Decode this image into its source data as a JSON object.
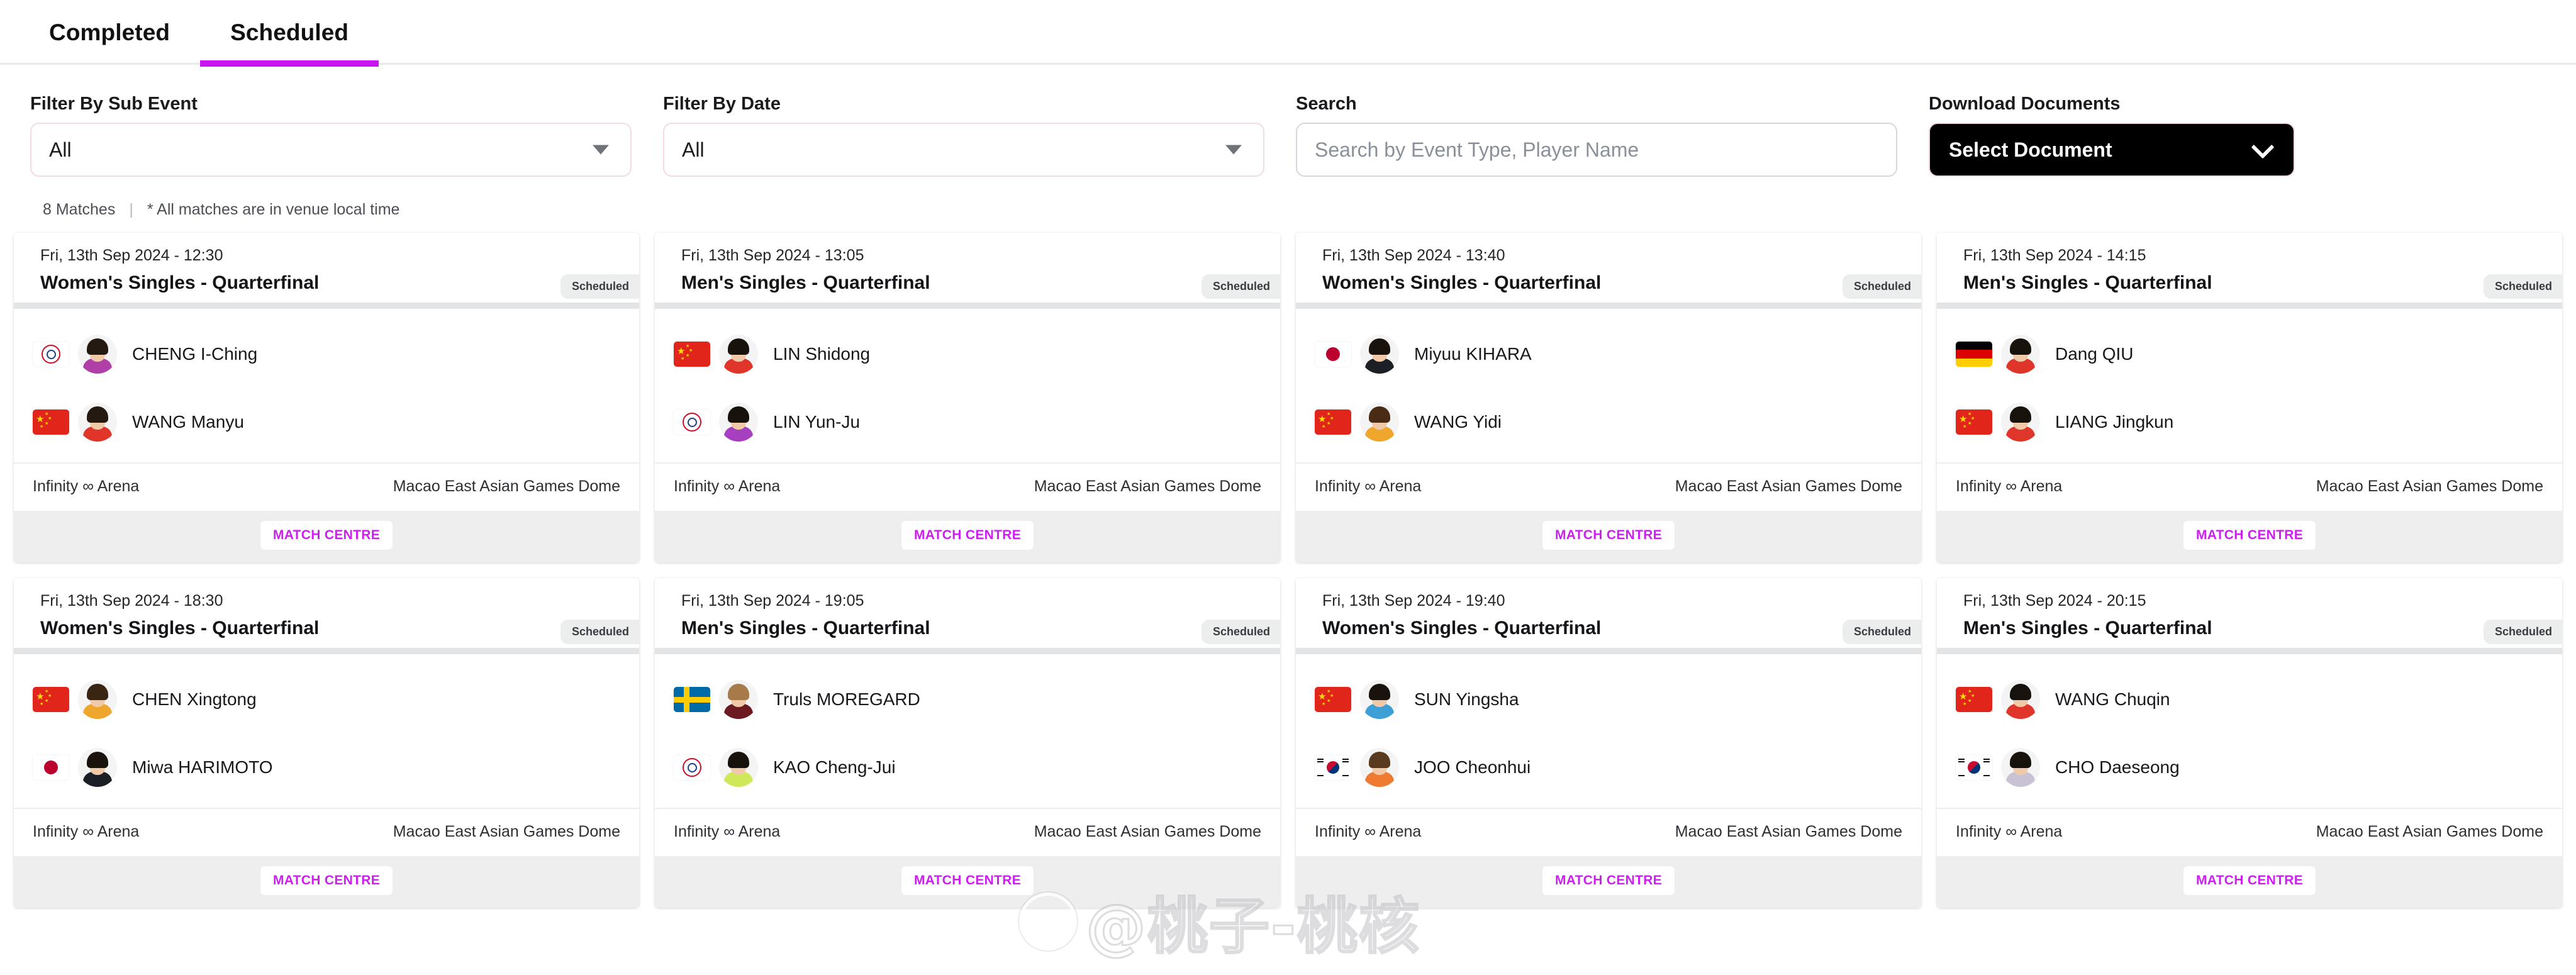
{
  "tabs": [
    {
      "label": "Completed",
      "active": false
    },
    {
      "label": "Scheduled",
      "active": true
    }
  ],
  "filters": {
    "sub_event": {
      "label": "Filter By Sub Event",
      "value": "All"
    },
    "date": {
      "label": "Filter By Date",
      "value": "All"
    },
    "search": {
      "label": "Search",
      "value": "",
      "placeholder": "Search by Event Type, Player Name"
    },
    "download": {
      "label": "Download Documents",
      "value": "Select Document"
    }
  },
  "meta": {
    "match_count": "8 Matches",
    "separator": "|",
    "note": "* All matches are in venue local time"
  },
  "accent_color": "#c913f0",
  "match_centre_label": "MATCH CENTRE",
  "status_label": "Scheduled",
  "watermark": "@桃子-桃核",
  "matches": [
    {
      "datetime": "Fri, 13th Sep 2024 - 12:30",
      "title": "Women's Singles - Quarterfinal",
      "status": "Scheduled",
      "arena": "Infinity ∞ Arena",
      "venue": "Macao East Asian Games Dome",
      "button": "MATCH CENTRE",
      "players": [
        {
          "name": "CHENG I-Ching",
          "flag": "chinese-taipei",
          "kit": "#b13fa8",
          "hair": "#241a12"
        },
        {
          "name": "WANG Manyu",
          "flag": "china",
          "kit": "#e0352b",
          "hair": "#241a12"
        }
      ]
    },
    {
      "datetime": "Fri, 13th Sep 2024 - 13:05",
      "title": "Men's Singles - Quarterfinal",
      "status": "Scheduled",
      "arena": "Infinity ∞ Arena",
      "venue": "Macao East Asian Games Dome",
      "button": "MATCH CENTRE",
      "players": [
        {
          "name": "LIN Shidong",
          "flag": "china",
          "kit": "#e0352b",
          "hair": "#18120c"
        },
        {
          "name": "LIN Yun-Ju",
          "flag": "chinese-taipei",
          "kit": "#a63fc0",
          "hair": "#18120c"
        }
      ]
    },
    {
      "datetime": "Fri, 13th Sep 2024 - 13:40",
      "title": "Women's Singles - Quarterfinal",
      "status": "Scheduled",
      "arena": "Infinity ∞ Arena",
      "venue": "Macao East Asian Games Dome",
      "button": "MATCH CENTRE",
      "players": [
        {
          "name": "Miyuu KIHARA",
          "flag": "japan",
          "kit": "#1d1f27",
          "hair": "#1a130d"
        },
        {
          "name": "WANG Yidi",
          "flag": "china",
          "kit": "#efa62c",
          "hair": "#4a2c16"
        }
      ]
    },
    {
      "datetime": "Fri, 13th Sep 2024 - 14:15",
      "title": "Men's Singles - Quarterfinal",
      "status": "Scheduled",
      "arena": "Infinity ∞ Arena",
      "venue": "Macao East Asian Games Dome",
      "button": "MATCH CENTRE",
      "players": [
        {
          "name": "Dang QIU",
          "flag": "germany",
          "kit": "#e0352b",
          "hair": "#18120c"
        },
        {
          "name": "LIANG Jingkun",
          "flag": "china",
          "kit": "#e0352b",
          "hair": "#18120c"
        }
      ]
    },
    {
      "datetime": "Fri, 13th Sep 2024 - 18:30",
      "title": "Women's Singles - Quarterfinal",
      "status": "Scheduled",
      "arena": "Infinity ∞ Arena",
      "venue": "Macao East Asian Games Dome",
      "button": "MATCH CENTRE",
      "players": [
        {
          "name": "CHEN Xingtong",
          "flag": "china",
          "kit": "#efa62c",
          "hair": "#3a2412"
        },
        {
          "name": "Miwa HARIMOTO",
          "flag": "japan",
          "kit": "#1d1f27",
          "hair": "#1a130d"
        }
      ]
    },
    {
      "datetime": "Fri, 13th Sep 2024 - 19:05",
      "title": "Men's Singles - Quarterfinal",
      "status": "Scheduled",
      "arena": "Infinity ∞ Arena",
      "venue": "Macao East Asian Games Dome",
      "button": "MATCH CENTRE",
      "players": [
        {
          "name": "Truls MOREGARD",
          "flag": "sweden",
          "kit": "#6b1a1f",
          "hair": "#a77a4a"
        },
        {
          "name": "KAO Cheng-Jui",
          "flag": "chinese-taipei",
          "kit": "#cfe85a",
          "hair": "#18120c"
        }
      ]
    },
    {
      "datetime": "Fri, 13th Sep 2024 - 19:40",
      "title": "Women's Singles - Quarterfinal",
      "status": "Scheduled",
      "arena": "Infinity ∞ Arena",
      "venue": "Macao East Asian Games Dome",
      "button": "MATCH CENTRE",
      "players": [
        {
          "name": "SUN Yingsha",
          "flag": "china",
          "kit": "#3d9fd6",
          "hair": "#1a130d"
        },
        {
          "name": "JOO Cheonhui",
          "flag": "korea",
          "kit": "#ef7a32",
          "hair": "#5a3a1e"
        }
      ]
    },
    {
      "datetime": "Fri, 13th Sep 2024 - 20:15",
      "title": "Men's Singles - Quarterfinal",
      "status": "Scheduled",
      "arena": "Infinity ∞ Arena",
      "venue": "Macao East Asian Games Dome",
      "button": "MATCH CENTRE",
      "players": [
        {
          "name": "WANG Chuqin",
          "flag": "china",
          "kit": "#e0352b",
          "hair": "#18120c"
        },
        {
          "name": "CHO Daeseong",
          "flag": "korea",
          "kit": "#c9c2d4",
          "hair": "#18120c"
        }
      ]
    }
  ]
}
